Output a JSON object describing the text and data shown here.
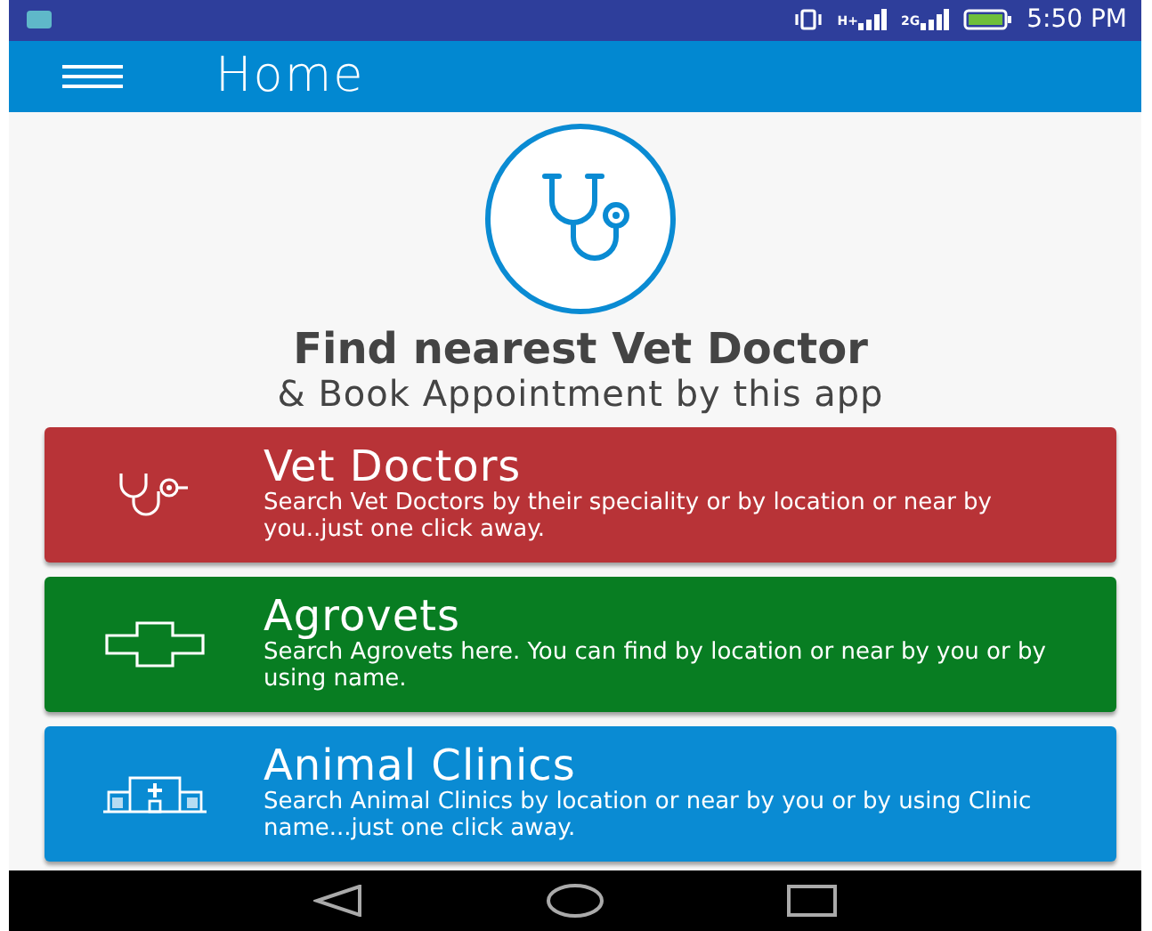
{
  "status_bar": {
    "signals": [
      {
        "label": "H+"
      },
      {
        "label": "2G"
      }
    ],
    "time": "5:50 PM"
  },
  "app_bar": {
    "title": "Home"
  },
  "hero": {
    "heading": "Find nearest Vet Doctor",
    "subheading": "& Book Appointment by this app"
  },
  "cards": [
    {
      "kind": "stethoscope",
      "title": "Vet Doctors",
      "description": "Search Vet Doctors by their speciality or by location or near by you..just one click away.",
      "color": "#b83337"
    },
    {
      "kind": "cross",
      "title": "Agrovets",
      "description": "Search Agrovets here. You can find by location or near by you or by using name.",
      "color": "#087d22"
    },
    {
      "kind": "clinic",
      "title": "Animal Clinics",
      "description": "Search Animal Clinics by location or near by you or by using Clinic name...just one click away.",
      "color": "#0a8bd3"
    }
  ]
}
